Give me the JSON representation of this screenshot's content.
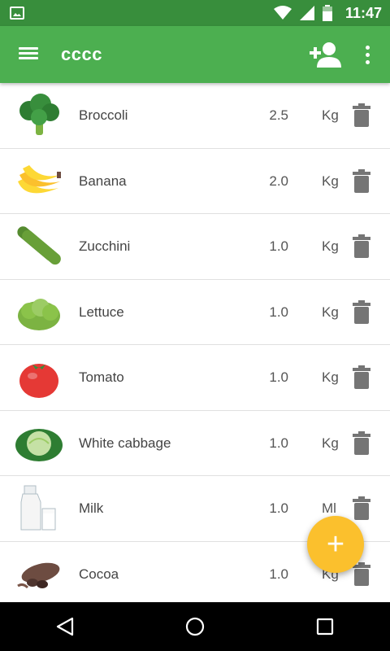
{
  "status_bar": {
    "time": "11:47"
  },
  "app_bar": {
    "title": "cccc"
  },
  "items": [
    {
      "name": "Broccoli",
      "qty": "2.5",
      "unit": "Kg",
      "icon": "broccoli-icon"
    },
    {
      "name": "Banana",
      "qty": "2.0",
      "unit": "Kg",
      "icon": "banana-icon"
    },
    {
      "name": "Zucchini",
      "qty": "1.0",
      "unit": "Kg",
      "icon": "zucchini-icon"
    },
    {
      "name": "Lettuce",
      "qty": "1.0",
      "unit": "Kg",
      "icon": "lettuce-icon"
    },
    {
      "name": "Tomato",
      "qty": "1.0",
      "unit": "Kg",
      "icon": "tomato-icon"
    },
    {
      "name": "White cabbage",
      "qty": "1.0",
      "unit": "Kg",
      "icon": "cabbage-icon"
    },
    {
      "name": "Milk",
      "qty": "1.0",
      "unit": "Ml",
      "icon": "milk-icon"
    },
    {
      "name": "Cocoa",
      "qty": "1.0",
      "unit": "Kg",
      "icon": "cocoa-icon"
    }
  ],
  "fab": {
    "label": "+"
  },
  "colors": {
    "primary": "#4caf50",
    "primary_dark": "#388e3c",
    "accent": "#fbc02d"
  }
}
